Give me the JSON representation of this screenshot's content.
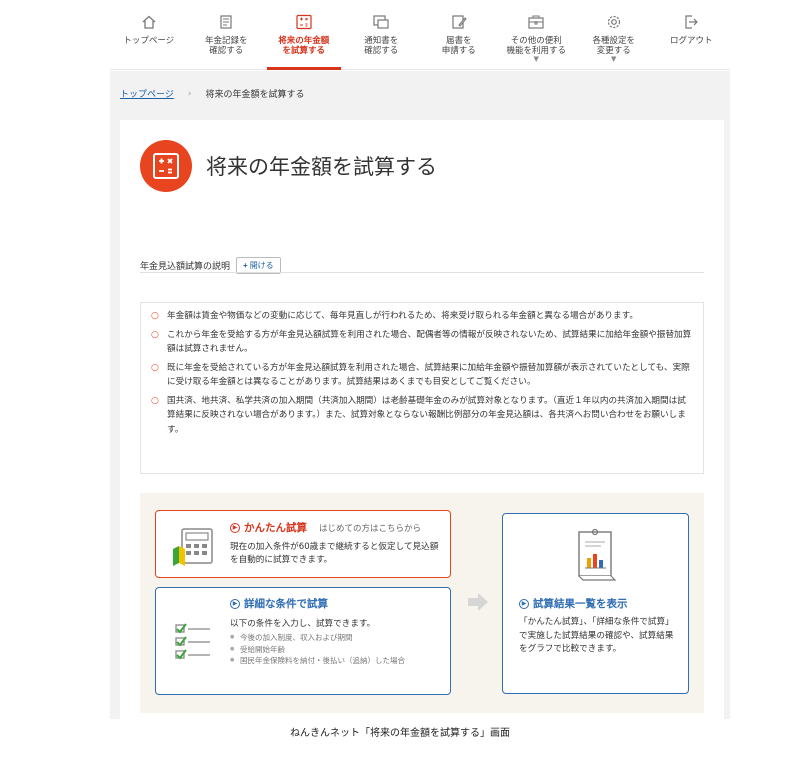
{
  "nav": {
    "items": [
      {
        "label": "トップページ",
        "icon": "home-icon"
      },
      {
        "label": "年金記録を\n確認する",
        "icon": "document-icon"
      },
      {
        "label": "将来の年金額\nを試算する",
        "icon": "calculator-icon",
        "active": true
      },
      {
        "label": "通知書を\n確認する",
        "icon": "notice-icon"
      },
      {
        "label": "届書を\n申請する",
        "icon": "form-edit-icon"
      },
      {
        "label": "その他の便利\n機能を利用する",
        "icon": "toolbox-icon",
        "dropdown": true
      },
      {
        "label": "各種設定を\n変更する",
        "icon": "gear-icon",
        "dropdown": true
      },
      {
        "label": "ログアウト",
        "icon": "logout-icon"
      }
    ]
  },
  "breadcrumb": {
    "home": "トップページ",
    "current": "将来の年金額を試算する"
  },
  "page": {
    "title": "将来の年金額を試算する"
  },
  "explain": {
    "label": "年金見込額試算の説明",
    "open_button": "開ける"
  },
  "notes": [
    "年金額は賃金や物価などの変動に応じて、毎年見直しが行われるため、将来受け取られる年金額と異なる場合があります。",
    "これから年金を受給する方が年金見込額試算を利用された場合、配偶者等の情報が反映されないため、試算結果に加給年金額や振替加算額は試算されません。",
    "既に年金を受給されている方が年金見込額試算を利用された場合、試算結果に加給年金額や振替加算額が表示されていたとしても、実際に受け取る年金額とは異なることがあります。試算結果はあくまでも目安としてご覧ください。",
    "国共済、地共済、私学共済の加入期間（共済加入期間）は老齢基礎年金のみが試算対象となります。（直近１年以内の共済加入期間は試算結果に反映されない場合があります。）また、試算対象とならない報酬比例部分の年金見込額は、各共済へお問い合わせをお願いします。"
  ],
  "easy": {
    "title": "かんたん試算",
    "subtitle": "はじめての方はこちらから",
    "description": "現在の加入条件が60歳まで継続すると仮定して見込額を自動的に試算できます。"
  },
  "detail": {
    "title": "詳細な条件で試算",
    "description": "以下の条件を入力し、試算できます。",
    "items": [
      "今後の加入制度、収入および期間",
      "受給開始年齢",
      "国民年金保険料を納付・後払い（追納）した場合"
    ]
  },
  "result": {
    "title": "試算結果一覧を表示",
    "description": "「かんたん試算」、「詳細な条件で試算」で実施した試算結果の確認や、試算結果をグラフで比較できます。"
  },
  "caption": "ねんきんネット「将来の年金額を試算する」画面",
  "colors": {
    "accent": "#e8441f",
    "blue": "#2f6db5",
    "link": "#1f5fa8"
  }
}
